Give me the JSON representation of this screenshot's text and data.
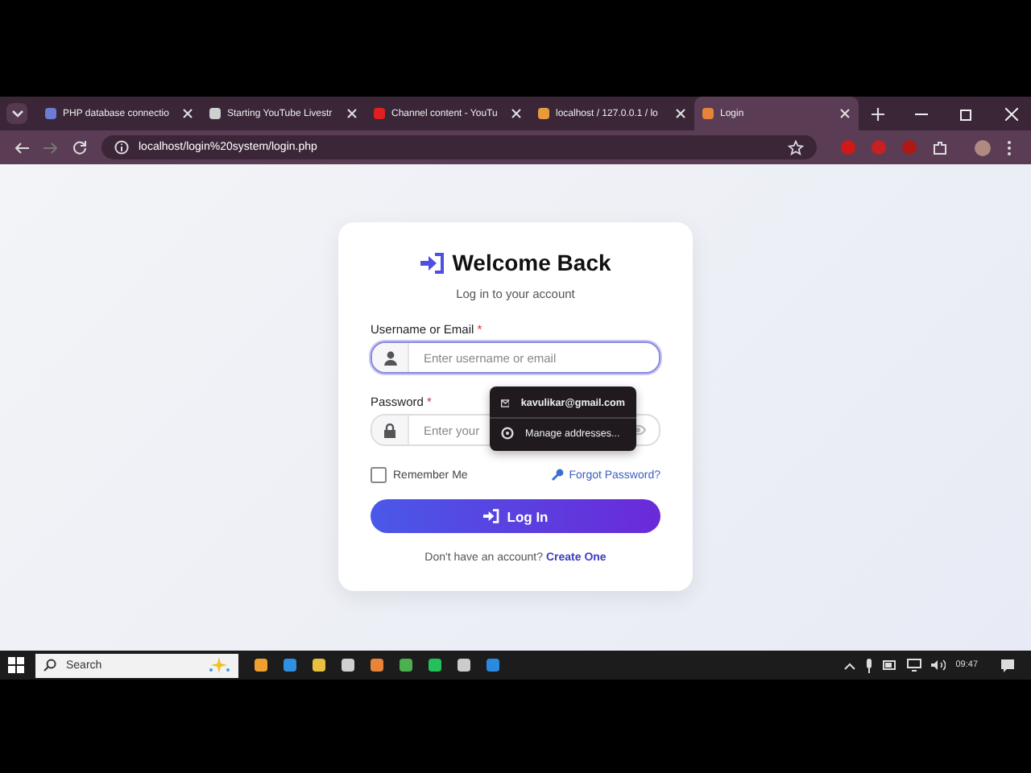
{
  "tabs": [
    {
      "title": "PHP database connectio",
      "selected": false
    },
    {
      "title": "Starting YouTube Livestr",
      "selected": false
    },
    {
      "title": "Channel content - YouTu",
      "selected": false
    },
    {
      "title": "localhost / 127.0.0.1 / lo",
      "selected": false
    },
    {
      "title": "Login",
      "selected": true
    }
  ],
  "address_bar": {
    "url": "localhost/login%20system/login.php"
  },
  "login": {
    "title": "Welcome Back",
    "subtitle": "Log in to your account",
    "username": {
      "label": "Username or Email",
      "required": "*",
      "placeholder": "Enter username or email"
    },
    "password": {
      "label": "Password",
      "required": "*",
      "placeholder": "Enter your"
    },
    "remember_me": {
      "label": "Remember Me",
      "checked": false
    },
    "forgot": "Forgot Password?",
    "submit": "Log In",
    "signup_prompt": "Don't have an account?",
    "signup_link": "Create One"
  },
  "autofill": [
    {
      "kind": "email",
      "text": "kavulikar@gmail.com"
    },
    {
      "kind": "manage",
      "text": "Manage addresses..."
    }
  ],
  "taskbar": {
    "search": "Search",
    "time": "09:47"
  }
}
